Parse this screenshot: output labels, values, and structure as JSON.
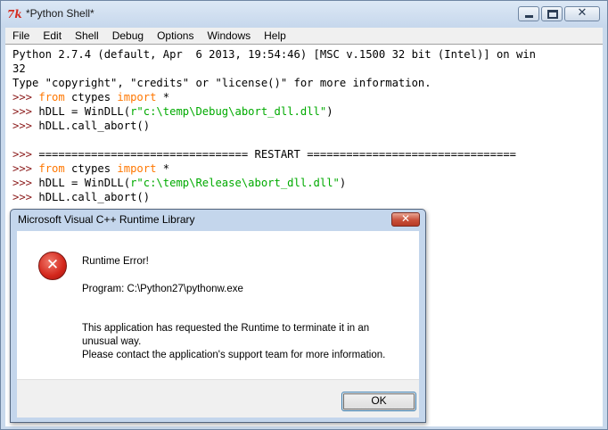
{
  "window": {
    "title": "*Python Shell*",
    "app_icon": "tk-feather-icon",
    "controls": [
      "minimize",
      "maximize",
      "close"
    ]
  },
  "menu": {
    "items": [
      {
        "label": "File"
      },
      {
        "label": "Edit"
      },
      {
        "label": "Shell"
      },
      {
        "label": "Debug"
      },
      {
        "label": "Options"
      },
      {
        "label": "Windows"
      },
      {
        "label": "Help"
      }
    ]
  },
  "shell": {
    "banner_line1": "Python 2.7.4 (default, Apr  6 2013, 19:54:46) [MSC v.1500 32 bit (Intel)] on win",
    "banner_line2": "32",
    "banner_line3": "Type \"copyright\", \"credits\" or \"license()\" for more information.",
    "prompt": ">>>",
    "kw_from": "from",
    "kw_import": "import",
    "line1_mod": " ctypes ",
    "line1_star": " *",
    "line2_pre": " hDLL = WinDLL(",
    "line2_str": "r\"c:\\temp\\Debug\\abort_dll.dll\"",
    "line2_post": ")",
    "line3": " hDLL.call_abort()",
    "restart": " ================================ RESTART ================================",
    "line5_str": "r\"c:\\temp\\Release\\abort_dll.dll\"",
    "line6": " hDLL.call_abort()"
  },
  "dialog": {
    "title": "Microsoft Visual C++ Runtime Library",
    "icon": "error-icon",
    "icon_glyph": "✕",
    "heading": "Runtime Error!",
    "program": "Program: C:\\Python27\\pythonw.exe",
    "message1": "This application has requested the Runtime to terminate it in an",
    "message2": "unusual way.",
    "message3": "Please contact the application's support team for more information.",
    "ok_label": "OK"
  },
  "colors": {
    "prompt": "#8b1a1a",
    "keyword": "#ff7700",
    "string": "#00aa00",
    "chrome": "#c9d9ec"
  }
}
